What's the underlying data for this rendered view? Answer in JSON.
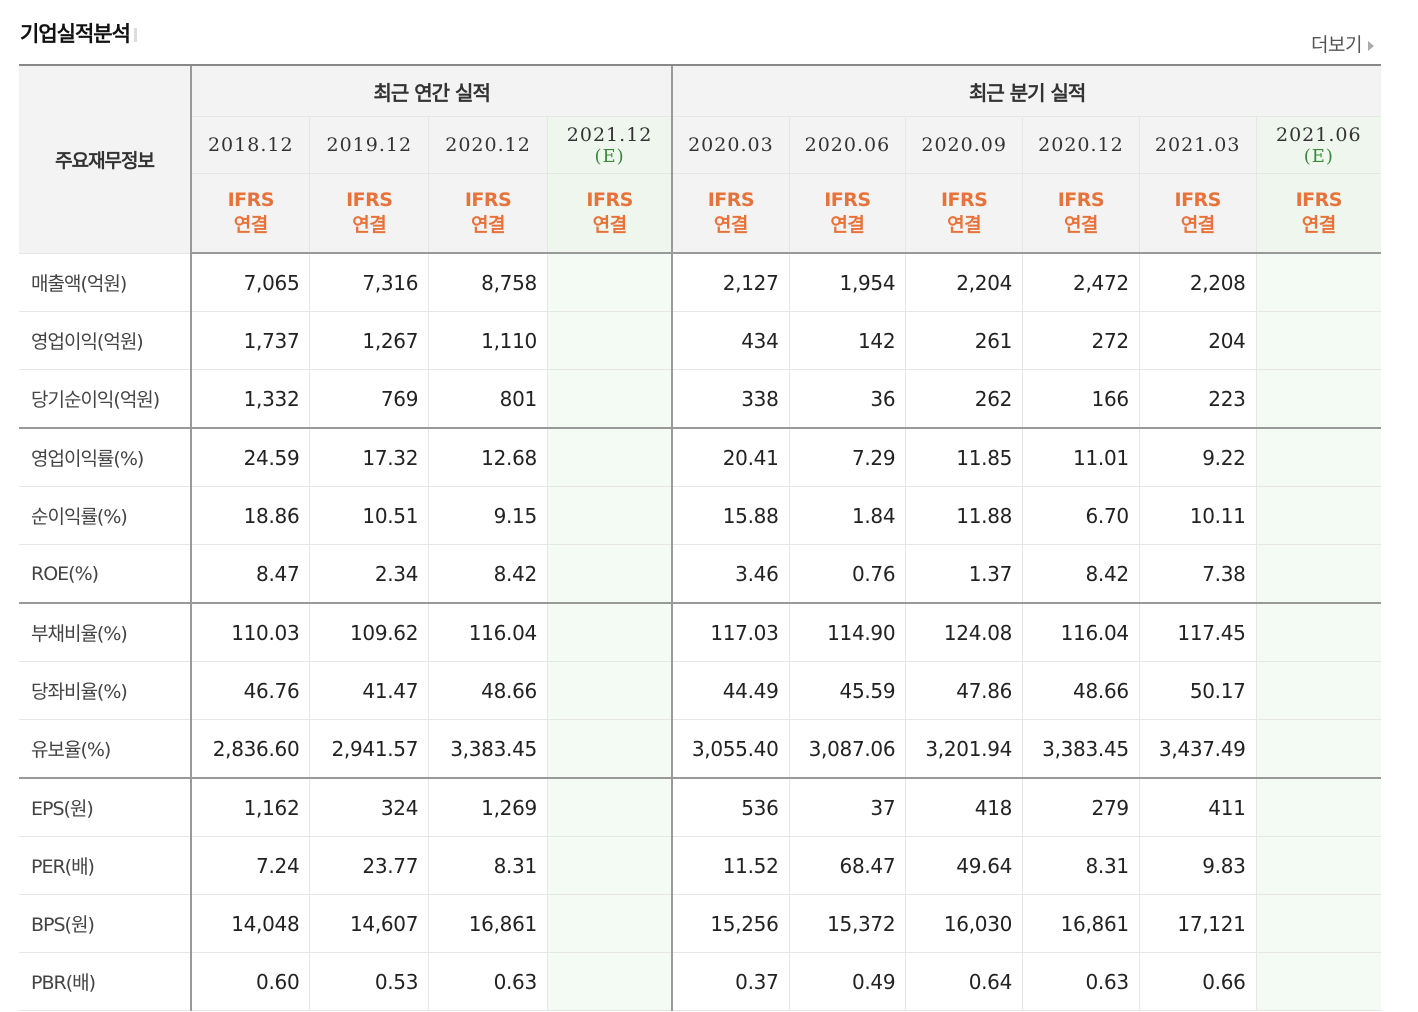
{
  "header": {
    "title": "기업실적분석",
    "more_label": "더보기"
  },
  "table": {
    "row_header": "주요재무정보",
    "annual_group": "최근 연간 실적",
    "quarter_group": "최근 분기 실적",
    "columns": [
      {
        "period": "2018.12",
        "est": "",
        "ifrs": "IFRS",
        "basis": "연결"
      },
      {
        "period": "2019.12",
        "est": "",
        "ifrs": "IFRS",
        "basis": "연결"
      },
      {
        "period": "2020.12",
        "est": "",
        "ifrs": "IFRS",
        "basis": "연결"
      },
      {
        "period": "2021.12",
        "est": "(E)",
        "ifrs": "IFRS",
        "basis": "연결"
      },
      {
        "period": "2020.03",
        "est": "",
        "ifrs": "IFRS",
        "basis": "연결"
      },
      {
        "period": "2020.06",
        "est": "",
        "ifrs": "IFRS",
        "basis": "연결"
      },
      {
        "period": "2020.09",
        "est": "",
        "ifrs": "IFRS",
        "basis": "연결"
      },
      {
        "period": "2020.12",
        "est": "",
        "ifrs": "IFRS",
        "basis": "연결"
      },
      {
        "period": "2021.03",
        "est": "",
        "ifrs": "IFRS",
        "basis": "연결"
      },
      {
        "period": "2021.06",
        "est": "(E)",
        "ifrs": "IFRS",
        "basis": "연결"
      }
    ],
    "rows": [
      {
        "label": "매출액(억원)",
        "values": [
          "7,065",
          "7,316",
          "8,758",
          "",
          "2,127",
          "1,954",
          "2,204",
          "2,472",
          "2,208",
          ""
        ]
      },
      {
        "label": "영업이익(억원)",
        "values": [
          "1,737",
          "1,267",
          "1,110",
          "",
          "434",
          "142",
          "261",
          "272",
          "204",
          ""
        ]
      },
      {
        "label": "당기순이익(억원)",
        "values": [
          "1,332",
          "769",
          "801",
          "",
          "338",
          "36",
          "262",
          "166",
          "223",
          ""
        ]
      },
      {
        "label": "영업이익률(%)",
        "values": [
          "24.59",
          "17.32",
          "12.68",
          "",
          "20.41",
          "7.29",
          "11.85",
          "11.01",
          "9.22",
          ""
        ]
      },
      {
        "label": "순이익률(%)",
        "values": [
          "18.86",
          "10.51",
          "9.15",
          "",
          "15.88",
          "1.84",
          "11.88",
          "6.70",
          "10.11",
          ""
        ]
      },
      {
        "label": "ROE(%)",
        "values": [
          "8.47",
          "2.34",
          "8.42",
          "",
          "3.46",
          "0.76",
          "1.37",
          "8.42",
          "7.38",
          ""
        ]
      },
      {
        "label": "부채비율(%)",
        "values": [
          "110.03",
          "109.62",
          "116.04",
          "",
          "117.03",
          "114.90",
          "124.08",
          "116.04",
          "117.45",
          ""
        ]
      },
      {
        "label": "당좌비율(%)",
        "values": [
          "46.76",
          "41.47",
          "48.66",
          "",
          "44.49",
          "45.59",
          "47.86",
          "48.66",
          "50.17",
          ""
        ]
      },
      {
        "label": "유보율(%)",
        "values": [
          "2,836.60",
          "2,941.57",
          "3,383.45",
          "",
          "3,055.40",
          "3,087.06",
          "3,201.94",
          "3,383.45",
          "3,437.49",
          ""
        ]
      },
      {
        "label": "EPS(원)",
        "values": [
          "1,162",
          "324",
          "1,269",
          "",
          "536",
          "37",
          "418",
          "279",
          "411",
          ""
        ]
      },
      {
        "label": "PER(배)",
        "values": [
          "7.24",
          "23.77",
          "8.31",
          "",
          "11.52",
          "68.47",
          "49.64",
          "8.31",
          "9.83",
          ""
        ]
      },
      {
        "label": "BPS(원)",
        "values": [
          "14,048",
          "14,607",
          "16,861",
          "",
          "15,256",
          "15,372",
          "16,030",
          "16,861",
          "17,121",
          ""
        ]
      },
      {
        "label": "PBR(배)",
        "values": [
          "0.60",
          "0.53",
          "0.63",
          "",
          "0.37",
          "0.49",
          "0.64",
          "0.63",
          "0.66",
          ""
        ]
      }
    ]
  }
}
